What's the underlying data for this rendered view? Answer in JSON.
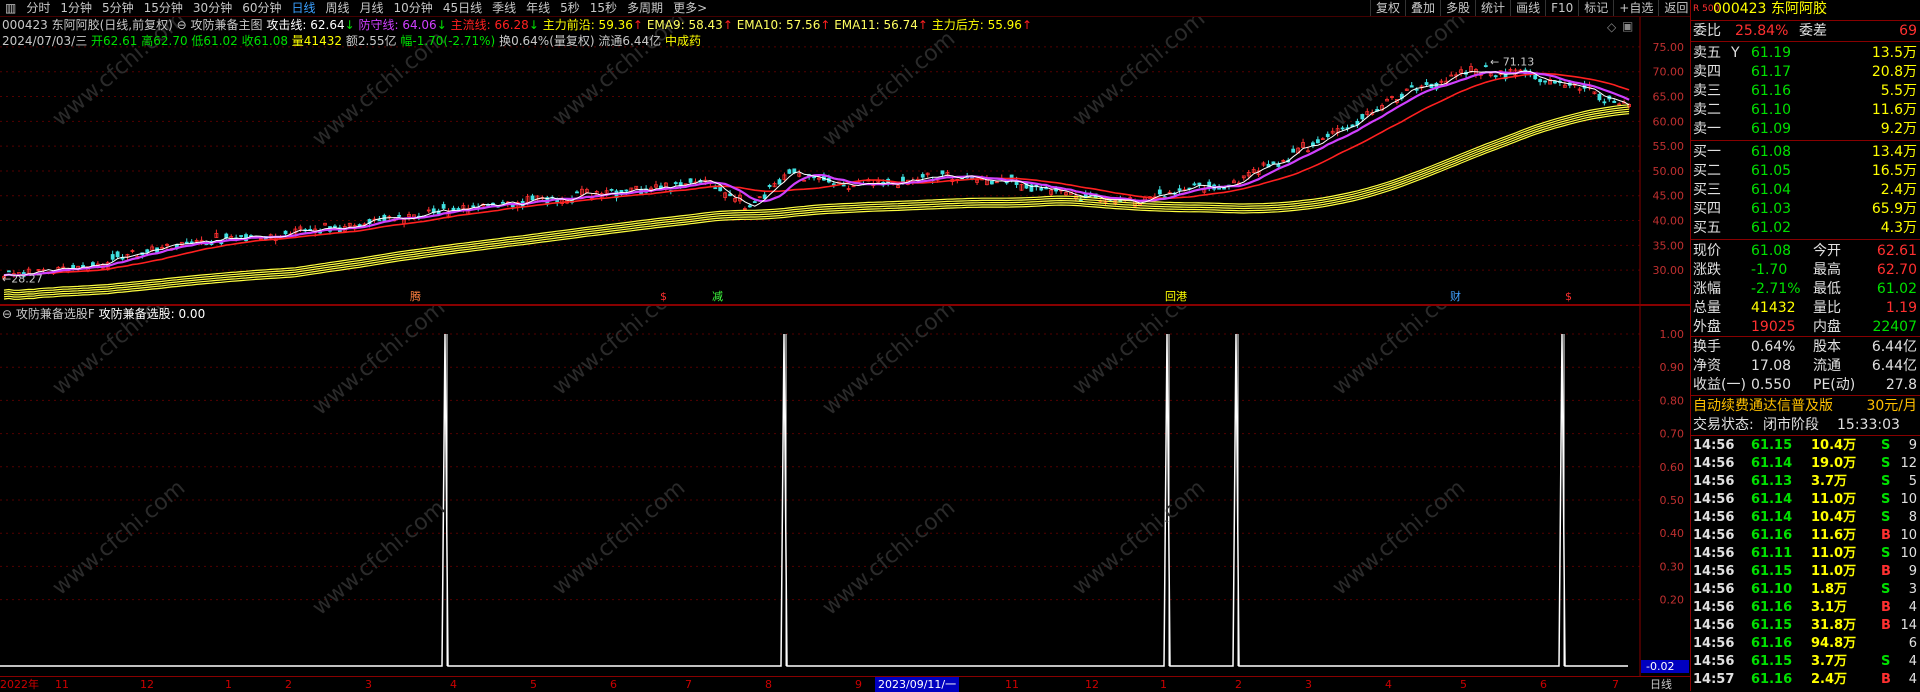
{
  "toolbar": {
    "periods": [
      "分时",
      "1分钟",
      "5分钟",
      "15分钟",
      "30分钟",
      "60分钟",
      "日线",
      "周线",
      "月线",
      "10分钟",
      "45日线",
      "季线",
      "年线",
      "5秒",
      "15秒",
      "多周期",
      "更多>"
    ],
    "active_period": "日线",
    "right_buttons": [
      "复权",
      "叠加",
      "多股",
      "统计",
      "画线",
      "F10",
      "标记",
      "+自选",
      "返回"
    ]
  },
  "main": {
    "title": "000423 东阿阿胶(日线,前复权)",
    "indicator_name": "攻防兼备主图",
    "attack_line": "攻击线: 62.64",
    "defense_line": "防守线: 64.06",
    "main_line": "主流线: 66.28",
    "force_front": "主力前沿: 59.36",
    "ema9": "EMA9: 58.43",
    "ema10": "EMA10: 57.56",
    "ema11": "EMA11: 56.74",
    "force_back": "主力后方: 55.96",
    "date": "2024/07/03/三",
    "open": "开62.61",
    "high": "高62.70",
    "low": "低61.02",
    "close": "收61.08",
    "volume": "量41432",
    "amount": "额2.55亿",
    "change": "幅-1.70(-2.71%)",
    "turnover": "换0.64%(量复权)",
    "float": "流通6.44亿",
    "sector": "中成药",
    "high_mark": "71.13",
    "low_mark": "28.27",
    "y_labels": [
      "75.00",
      "70.00",
      "65.00",
      "60.00",
      "55.00",
      "50.00",
      "45.00",
      "40.00",
      "35.00",
      "30.00"
    ],
    "markers": [
      "腾",
      "$",
      "减",
      "回港",
      "财",
      "$"
    ]
  },
  "indicator": {
    "title": "攻防兼备选股F",
    "value": "攻防兼备选股: 0.00",
    "y_labels": [
      "1.00",
      "0.90",
      "0.80",
      "0.70",
      "0.60",
      "0.50",
      "0.40",
      "0.30",
      "0.20"
    ],
    "current": "-0.02"
  },
  "x_axis": {
    "labels": [
      "2022年",
      "11",
      "12",
      "1",
      "2",
      "3",
      "4",
      "5",
      "6",
      "7",
      "8",
      "9",
      "10",
      "11",
      "12",
      "1",
      "2",
      "3",
      "4",
      "5",
      "6",
      "7"
    ],
    "highlight": "2023/09/11/一",
    "period": "日线"
  },
  "watermark": "www.cfchi.com",
  "right_panel": {
    "code": "000423",
    "name": "东阿阿胶",
    "badge": "R 500",
    "weibi_label": "委比",
    "weibi": "25.84%",
    "weicha_label": "委差",
    "weicha": "69",
    "sells": [
      {
        "label": "卖五",
        "flag": "Y",
        "price": "61.19",
        "vol": "13.5万"
      },
      {
        "label": "卖四",
        "flag": "",
        "price": "61.17",
        "vol": "20.8万"
      },
      {
        "label": "卖三",
        "flag": "",
        "price": "61.16",
        "vol": "5.5万"
      },
      {
        "label": "卖二",
        "flag": "",
        "price": "61.10",
        "vol": "11.6万"
      },
      {
        "label": "卖一",
        "flag": "",
        "price": "61.09",
        "vol": "9.2万"
      }
    ],
    "buys": [
      {
        "label": "买一",
        "price": "61.08",
        "vol": "13.4万"
      },
      {
        "label": "买二",
        "price": "61.05",
        "vol": "16.5万"
      },
      {
        "label": "买三",
        "price": "61.04",
        "vol": "2.4万"
      },
      {
        "label": "买四",
        "price": "61.03",
        "vol": "65.9万"
      },
      {
        "label": "买五",
        "price": "61.02",
        "vol": "4.3万"
      }
    ],
    "stats": [
      {
        "l1": "现价",
        "v1": "61.08",
        "l2": "今开",
        "v2": "62.61"
      },
      {
        "l1": "涨跌",
        "v1": "-1.70",
        "l2": "最高",
        "v2": "62.70"
      },
      {
        "l1": "涨幅",
        "v1": "-2.71%",
        "l2": "最低",
        "v2": "61.02"
      },
      {
        "l1": "总量",
        "v1": "41432",
        "l2": "量比",
        "v2": "1.19"
      },
      {
        "l1": "外盘",
        "v1": "19025",
        "l2": "内盘",
        "v2": "22407"
      }
    ],
    "fund": [
      {
        "l1": "换手",
        "v1": "0.64%",
        "l2": "股本",
        "v2": "6.44亿"
      },
      {
        "l1": "净资",
        "v1": "17.08",
        "l2": "流通",
        "v2": "6.44亿"
      },
      {
        "l1": "收益(一)",
        "v1": "0.550",
        "l2": "PE(动)",
        "v2": "27.8"
      }
    ],
    "promo": "自动续费通达信普及版",
    "promo_price": "30元/月",
    "trade_status_label": "交易状态:",
    "trade_status": "闭市阶段",
    "trade_time": "15:33:03",
    "ticks": [
      {
        "t": "14:56",
        "p": "61.15",
        "v": "10.4万",
        "s": "S",
        "n": "9"
      },
      {
        "t": "14:56",
        "p": "61.14",
        "v": "19.0万",
        "s": "S",
        "n": "12"
      },
      {
        "t": "14:56",
        "p": "61.13",
        "v": "3.7万",
        "s": "S",
        "n": "5"
      },
      {
        "t": "14:56",
        "p": "61.14",
        "v": "11.0万",
        "s": "S",
        "n": "10"
      },
      {
        "t": "14:56",
        "p": "61.14",
        "v": "10.4万",
        "s": "S",
        "n": "8"
      },
      {
        "t": "14:56",
        "p": "61.16",
        "v": "11.6万",
        "s": "B",
        "n": "10"
      },
      {
        "t": "14:56",
        "p": "61.11",
        "v": "11.0万",
        "s": "S",
        "n": "10"
      },
      {
        "t": "14:56",
        "p": "61.15",
        "v": "11.0万",
        "s": "B",
        "n": "9"
      },
      {
        "t": "14:56",
        "p": "61.10",
        "v": "1.8万",
        "s": "S",
        "n": "3"
      },
      {
        "t": "14:56",
        "p": "61.16",
        "v": "3.1万",
        "s": "B",
        "n": "4"
      },
      {
        "t": "14:56",
        "p": "61.15",
        "v": "31.8万",
        "s": "B",
        "n": "14"
      },
      {
        "t": "14:56",
        "p": "61.16",
        "v": "94.8万",
        "s": "",
        "n": "6"
      },
      {
        "t": "14:56",
        "p": "61.15",
        "v": "3.7万",
        "s": "S",
        "n": "4"
      },
      {
        "t": "14:57",
        "p": "61.16",
        "v": "2.4万",
        "s": "B",
        "n": "4"
      }
    ],
    "colors": {
      "up": "#ff3030",
      "down": "#00e000",
      "flat": "#ffff00"
    }
  }
}
